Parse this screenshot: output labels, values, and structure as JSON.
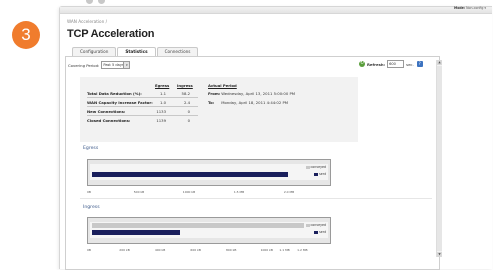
{
  "step_number": "3",
  "header": {
    "mode_label": "Mode:",
    "mode_value": "Non-config ▾"
  },
  "breadcrumb": "WAN Acceleration /",
  "page_title": "TCP Acceleration",
  "tabs": [
    {
      "label": "Configuration",
      "active": false
    },
    {
      "label": "Statistics",
      "active": true
    },
    {
      "label": "Connections",
      "active": false
    }
  ],
  "toolbar": {
    "period_label": "Covering Period:",
    "period_value": "Past 5 days",
    "refresh_label": "Refresh:",
    "refresh_value": "600",
    "refresh_unit": "sec."
  },
  "stats": {
    "col_egress": "Egress",
    "col_ingress": "Ingress",
    "rows": [
      {
        "label": "Total Data Reduction (%):",
        "egress": "1.1",
        "ingress": "58.2"
      },
      {
        "label": "WAN Capacity Increase Factor:",
        "egress": "1.0",
        "ingress": "2.4"
      },
      {
        "label": "New Connections:",
        "egress": "1133",
        "ingress": "0"
      },
      {
        "label": "Closed Connections:",
        "egress": "1139",
        "ingress": "0"
      }
    ],
    "actual_period_label": "Actual Period",
    "from_label": "From:",
    "from_value": "Wednesday, April 13, 2011 5:00:00 PM",
    "to_label": "To:",
    "to_value": "Monday, April 18, 2011 4:44:02 PM"
  },
  "chart_data": [
    {
      "type": "bar",
      "title": "Egress",
      "series": [
        {
          "name": "conveyed",
          "values": [
            0
          ]
        },
        {
          "name": "sent",
          "values": [
            1.98
          ]
        }
      ],
      "x_ticks": [
        "0B",
        "500 kB",
        "1000 kB",
        "1.5 MB",
        "2.0 MB"
      ],
      "x_tick_values": [
        0,
        0.5,
        1.0,
        1.5,
        2.0
      ],
      "xlim": [
        0,
        2.4
      ],
      "colors": {
        "conveyed": "#c8c8c8",
        "sent": "#1a1f5c"
      }
    },
    {
      "type": "bar",
      "title": "Ingress",
      "series": [
        {
          "name": "conveyed",
          "values": [
            1200
          ]
        },
        {
          "name": "sent",
          "values": [
            500
          ]
        }
      ],
      "x_ticks": [
        "0B",
        "200 kB",
        "400 kB",
        "600 kB",
        "800 kB",
        "1000 kB",
        "1.1 MB",
        "1.2 MB"
      ],
      "x_tick_values": [
        0,
        200,
        400,
        600,
        800,
        1000,
        1100,
        1200
      ],
      "xlim": [
        0,
        1350
      ],
      "colors": {
        "conveyed": "#c8c8c8",
        "sent": "#1a1f5c"
      }
    }
  ]
}
